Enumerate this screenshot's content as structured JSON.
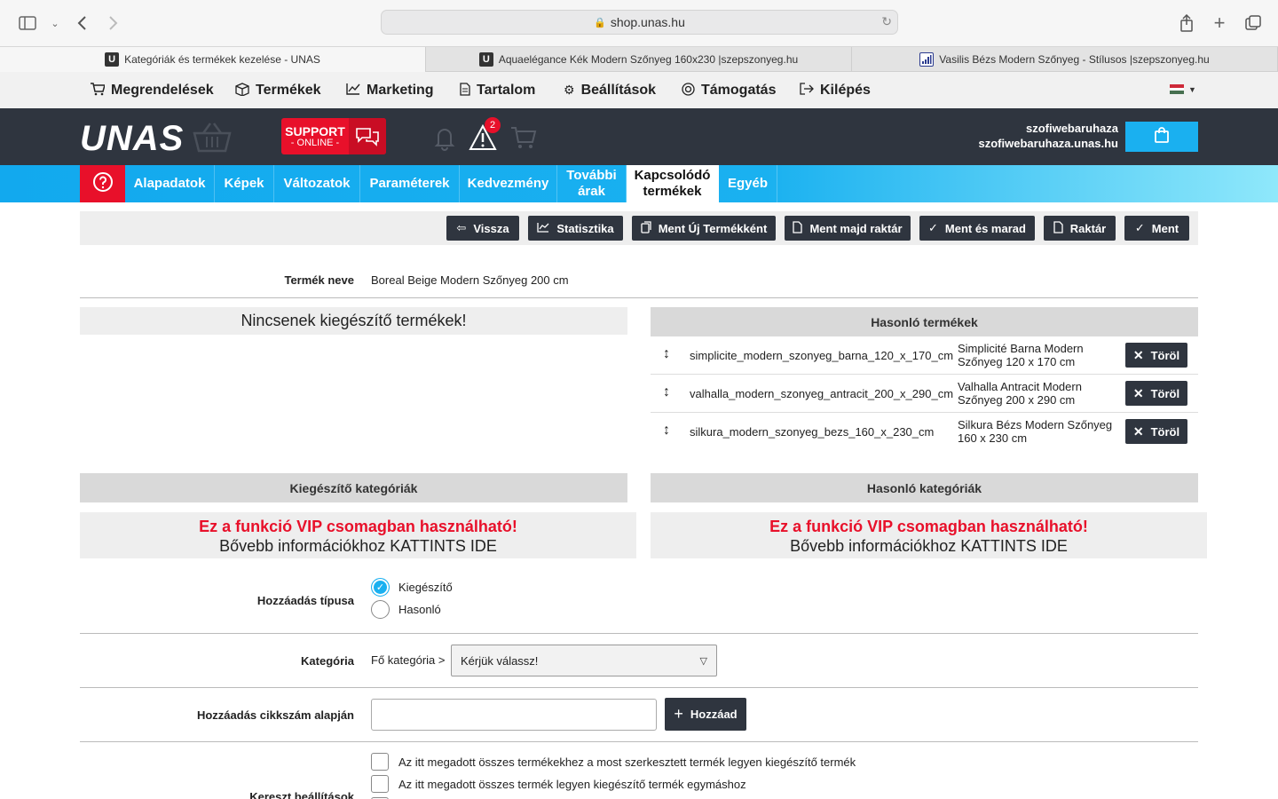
{
  "browser": {
    "url": "shop.unas.hu",
    "tabs": [
      {
        "label": "Kategóriák és termékek kezelése - UNAS",
        "favicon": "U"
      },
      {
        "label": "Aquaelégance Kék Modern Szőnyeg 160x230 |szepszonyeg.hu",
        "favicon": "U"
      },
      {
        "label": "Vasilis Bézs Modern Szőnyeg - Stílusos |szepszonyeg.hu",
        "favicon": "bars"
      }
    ]
  },
  "admin_menu": {
    "items": [
      {
        "label": "Megrendelések",
        "icon": "cart-icon"
      },
      {
        "label": "Termékek",
        "icon": "box-icon"
      },
      {
        "label": "Marketing",
        "icon": "chart-icon"
      },
      {
        "label": "Tartalom",
        "icon": "document-icon"
      },
      {
        "label": "Beállítások",
        "icon": "gear-icon"
      },
      {
        "label": "Támogatás",
        "icon": "lifebuoy-icon"
      },
      {
        "label": "Kilépés",
        "icon": "logout-icon"
      }
    ]
  },
  "header": {
    "logo": "UNAS",
    "support_line1": "SUPPORT",
    "support_line2": "- ONLINE -",
    "warning_count": "2",
    "shop_user": "szofiwebaruhaza",
    "shop_domain": "szofiwebaruhaza.unas.hu",
    "colors": {
      "dark": "#2f353f",
      "accent_blue": "#1ab0f0",
      "accent_red": "#e8102a"
    }
  },
  "product_tabs": [
    {
      "label": "Alapadatok"
    },
    {
      "label": "Képek"
    },
    {
      "label": "Változatok"
    },
    {
      "label": "Paraméterek"
    },
    {
      "label": "Kedvezmény"
    },
    {
      "label": "További árak"
    },
    {
      "label": "Kapcsolódó termékek",
      "active": true
    },
    {
      "label": "Egyéb"
    }
  ],
  "actions": {
    "back": "Vissza",
    "stats": "Statisztika",
    "save_as_new": "Ment Új Termékként",
    "save_then_stock": "Ment majd raktár",
    "save_and_stay": "Ment és marad",
    "stock": "Raktár",
    "save": "Ment"
  },
  "product": {
    "name_label": "Termék neve",
    "name_value": "Boreal Beige Modern Szőnyeg 200 cm"
  },
  "complementary": {
    "empty_text": "Nincsenek kiegészítő termékek!"
  },
  "similar": {
    "title": "Hasonló termékek",
    "delete_label": "Töröl",
    "rows": [
      {
        "code": "simplicite_modern_szonyeg_barna_120_x_170_cm",
        "name": "Simplicité Barna Modern Szőnyeg 120 x 170 cm"
      },
      {
        "code": "valhalla_modern_szonyeg_antracit_200_x_290_cm",
        "name": "Valhalla Antracit Modern Szőnyeg 200 x 290 cm"
      },
      {
        "code": "silkura_modern_szonyeg_bezs_160_x_230_cm",
        "name": "Silkura Bézs Modern Szőnyeg 160 x 230 cm"
      }
    ]
  },
  "categories": {
    "complementary_title": "Kiegészítő kategóriák",
    "similar_title": "Hasonló kategóriák",
    "vip_line1": "Ez a funkció VIP csomagban használható!",
    "vip_line2": "Bővebb információkhoz KATTINTS IDE"
  },
  "form": {
    "add_type_label": "Hozzáadás típusa",
    "opt_complementary": "Kiegészítő",
    "opt_similar": "Hasonló",
    "category_label": "Kategória",
    "category_prefix": "Fő kategória >",
    "category_select": "Kérjük válassz!",
    "by_sku_label": "Hozzáadás cikkszám alapján",
    "sku_value": "",
    "add_button": "Hozzáad",
    "cross_label": "Kereszt beállítások",
    "cross_opt1": "Az itt megadott összes termékekhez a most szerkesztett termék legyen kiegészítő termék",
    "cross_opt2": "Az itt megadott összes termék legyen kiegészítő termék egymáshoz"
  }
}
